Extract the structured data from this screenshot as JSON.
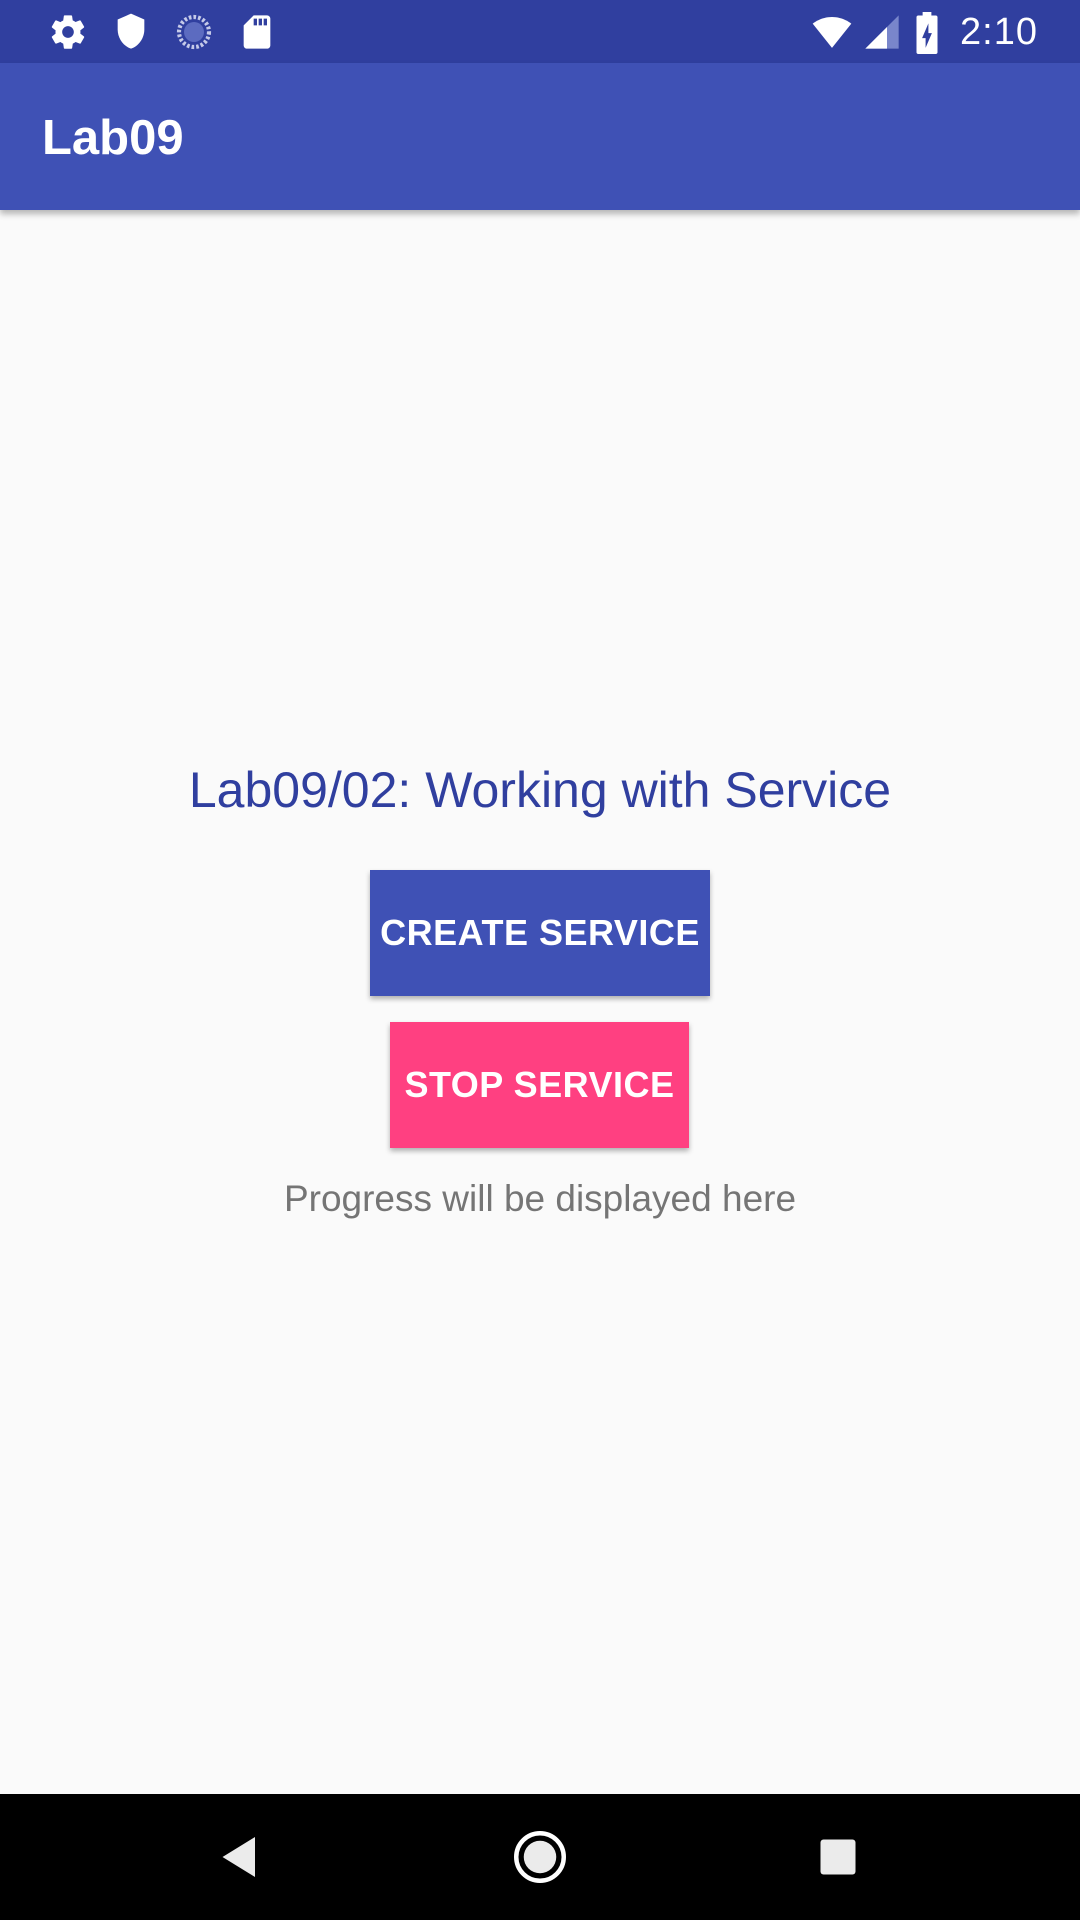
{
  "status_bar": {
    "time": "2:10",
    "left_icons": [
      "gear-icon",
      "shield-icon",
      "sync-spinner-icon",
      "sd-card-icon"
    ],
    "right_icons": [
      "wifi-icon",
      "cell-signal-icon",
      "battery-charging-icon"
    ]
  },
  "app_bar": {
    "title": "Lab09",
    "color": "#3f51b5"
  },
  "main": {
    "heading": "Lab09/02: Working with Service",
    "create_button_label": "CREATE SERVICE",
    "stop_button_label": "STOP SERVICE",
    "progress_text": "Progress will be displayed here"
  },
  "nav_bar": {
    "buttons": [
      "back-icon",
      "home-icon",
      "recents-icon"
    ]
  },
  "colors": {
    "primary": "#3f51b5",
    "primary_dark": "#303f9f",
    "accent": "#ff4081",
    "background": "#fafafa"
  }
}
